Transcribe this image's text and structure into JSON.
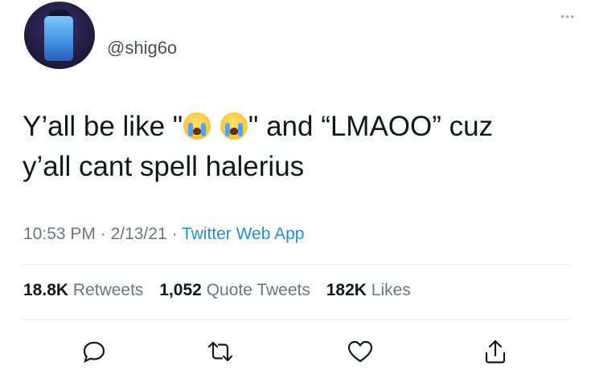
{
  "tweet": {
    "handle": "@shig6o",
    "more_icon": "more-dots-icon",
    "text_part1": "Y’all be like \"",
    "text_part2": "\" and “LMAOO” cuz",
    "text_line2": "y’all cant spell halerius",
    "emojis": [
      "loudly-crying-face-icon",
      "loudly-crying-face-icon"
    ],
    "time": "10:53 PM",
    "sep1": " · ",
    "date": "2/13/21",
    "sep2": " · ",
    "source": "Twitter Web App"
  },
  "stats": {
    "retweets_count": "18.8K",
    "retweets_label": "Retweets",
    "quotes_count": "1,052",
    "quotes_label": "Quote Tweets",
    "likes_count": "182K",
    "likes_label": "Likes"
  },
  "actions": [
    "reply-icon",
    "retweet-icon",
    "like-icon",
    "share-icon"
  ],
  "colors": {
    "link": "#1d8fe0",
    "meta": "#6b7680",
    "text": "#14171a"
  }
}
